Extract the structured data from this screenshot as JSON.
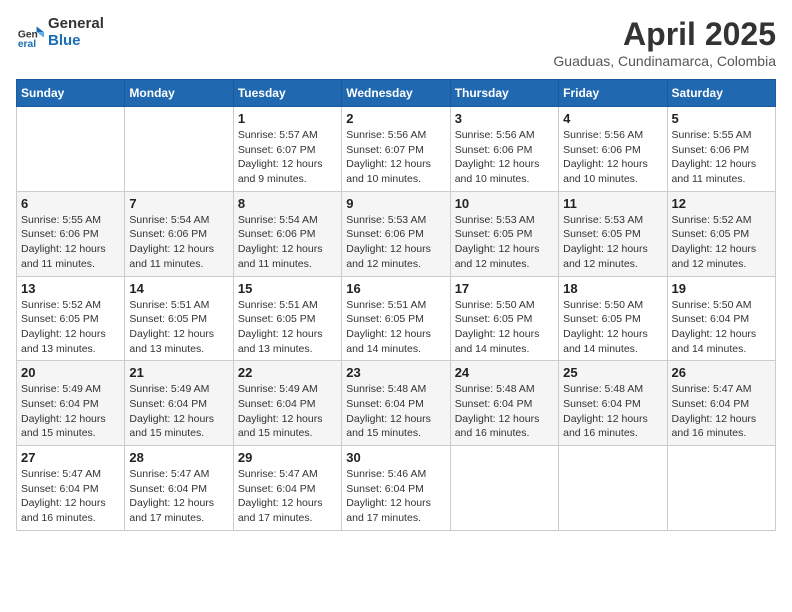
{
  "header": {
    "logo": {
      "general": "General",
      "blue": "Blue"
    },
    "title": "April 2025",
    "subtitle": "Guaduas, Cundinamarca, Colombia"
  },
  "weekdays": [
    "Sunday",
    "Monday",
    "Tuesday",
    "Wednesday",
    "Thursday",
    "Friday",
    "Saturday"
  ],
  "weeks": [
    [
      {
        "day": "",
        "sunrise": "",
        "sunset": "",
        "daylight": ""
      },
      {
        "day": "",
        "sunrise": "",
        "sunset": "",
        "daylight": ""
      },
      {
        "day": "1",
        "sunrise": "Sunrise: 5:57 AM",
        "sunset": "Sunset: 6:07 PM",
        "daylight": "Daylight: 12 hours and 9 minutes."
      },
      {
        "day": "2",
        "sunrise": "Sunrise: 5:56 AM",
        "sunset": "Sunset: 6:07 PM",
        "daylight": "Daylight: 12 hours and 10 minutes."
      },
      {
        "day": "3",
        "sunrise": "Sunrise: 5:56 AM",
        "sunset": "Sunset: 6:06 PM",
        "daylight": "Daylight: 12 hours and 10 minutes."
      },
      {
        "day": "4",
        "sunrise": "Sunrise: 5:56 AM",
        "sunset": "Sunset: 6:06 PM",
        "daylight": "Daylight: 12 hours and 10 minutes."
      },
      {
        "day": "5",
        "sunrise": "Sunrise: 5:55 AM",
        "sunset": "Sunset: 6:06 PM",
        "daylight": "Daylight: 12 hours and 11 minutes."
      }
    ],
    [
      {
        "day": "6",
        "sunrise": "Sunrise: 5:55 AM",
        "sunset": "Sunset: 6:06 PM",
        "daylight": "Daylight: 12 hours and 11 minutes."
      },
      {
        "day": "7",
        "sunrise": "Sunrise: 5:54 AM",
        "sunset": "Sunset: 6:06 PM",
        "daylight": "Daylight: 12 hours and 11 minutes."
      },
      {
        "day": "8",
        "sunrise": "Sunrise: 5:54 AM",
        "sunset": "Sunset: 6:06 PM",
        "daylight": "Daylight: 12 hours and 11 minutes."
      },
      {
        "day": "9",
        "sunrise": "Sunrise: 5:53 AM",
        "sunset": "Sunset: 6:06 PM",
        "daylight": "Daylight: 12 hours and 12 minutes."
      },
      {
        "day": "10",
        "sunrise": "Sunrise: 5:53 AM",
        "sunset": "Sunset: 6:05 PM",
        "daylight": "Daylight: 12 hours and 12 minutes."
      },
      {
        "day": "11",
        "sunrise": "Sunrise: 5:53 AM",
        "sunset": "Sunset: 6:05 PM",
        "daylight": "Daylight: 12 hours and 12 minutes."
      },
      {
        "day": "12",
        "sunrise": "Sunrise: 5:52 AM",
        "sunset": "Sunset: 6:05 PM",
        "daylight": "Daylight: 12 hours and 12 minutes."
      }
    ],
    [
      {
        "day": "13",
        "sunrise": "Sunrise: 5:52 AM",
        "sunset": "Sunset: 6:05 PM",
        "daylight": "Daylight: 12 hours and 13 minutes."
      },
      {
        "day": "14",
        "sunrise": "Sunrise: 5:51 AM",
        "sunset": "Sunset: 6:05 PM",
        "daylight": "Daylight: 12 hours and 13 minutes."
      },
      {
        "day": "15",
        "sunrise": "Sunrise: 5:51 AM",
        "sunset": "Sunset: 6:05 PM",
        "daylight": "Daylight: 12 hours and 13 minutes."
      },
      {
        "day": "16",
        "sunrise": "Sunrise: 5:51 AM",
        "sunset": "Sunset: 6:05 PM",
        "daylight": "Daylight: 12 hours and 14 minutes."
      },
      {
        "day": "17",
        "sunrise": "Sunrise: 5:50 AM",
        "sunset": "Sunset: 6:05 PM",
        "daylight": "Daylight: 12 hours and 14 minutes."
      },
      {
        "day": "18",
        "sunrise": "Sunrise: 5:50 AM",
        "sunset": "Sunset: 6:05 PM",
        "daylight": "Daylight: 12 hours and 14 minutes."
      },
      {
        "day": "19",
        "sunrise": "Sunrise: 5:50 AM",
        "sunset": "Sunset: 6:04 PM",
        "daylight": "Daylight: 12 hours and 14 minutes."
      }
    ],
    [
      {
        "day": "20",
        "sunrise": "Sunrise: 5:49 AM",
        "sunset": "Sunset: 6:04 PM",
        "daylight": "Daylight: 12 hours and 15 minutes."
      },
      {
        "day": "21",
        "sunrise": "Sunrise: 5:49 AM",
        "sunset": "Sunset: 6:04 PM",
        "daylight": "Daylight: 12 hours and 15 minutes."
      },
      {
        "day": "22",
        "sunrise": "Sunrise: 5:49 AM",
        "sunset": "Sunset: 6:04 PM",
        "daylight": "Daylight: 12 hours and 15 minutes."
      },
      {
        "day": "23",
        "sunrise": "Sunrise: 5:48 AM",
        "sunset": "Sunset: 6:04 PM",
        "daylight": "Daylight: 12 hours and 15 minutes."
      },
      {
        "day": "24",
        "sunrise": "Sunrise: 5:48 AM",
        "sunset": "Sunset: 6:04 PM",
        "daylight": "Daylight: 12 hours and 16 minutes."
      },
      {
        "day": "25",
        "sunrise": "Sunrise: 5:48 AM",
        "sunset": "Sunset: 6:04 PM",
        "daylight": "Daylight: 12 hours and 16 minutes."
      },
      {
        "day": "26",
        "sunrise": "Sunrise: 5:47 AM",
        "sunset": "Sunset: 6:04 PM",
        "daylight": "Daylight: 12 hours and 16 minutes."
      }
    ],
    [
      {
        "day": "27",
        "sunrise": "Sunrise: 5:47 AM",
        "sunset": "Sunset: 6:04 PM",
        "daylight": "Daylight: 12 hours and 16 minutes."
      },
      {
        "day": "28",
        "sunrise": "Sunrise: 5:47 AM",
        "sunset": "Sunset: 6:04 PM",
        "daylight": "Daylight: 12 hours and 17 minutes."
      },
      {
        "day": "29",
        "sunrise": "Sunrise: 5:47 AM",
        "sunset": "Sunset: 6:04 PM",
        "daylight": "Daylight: 12 hours and 17 minutes."
      },
      {
        "day": "30",
        "sunrise": "Sunrise: 5:46 AM",
        "sunset": "Sunset: 6:04 PM",
        "daylight": "Daylight: 12 hours and 17 minutes."
      },
      {
        "day": "",
        "sunrise": "",
        "sunset": "",
        "daylight": ""
      },
      {
        "day": "",
        "sunrise": "",
        "sunset": "",
        "daylight": ""
      },
      {
        "day": "",
        "sunrise": "",
        "sunset": "",
        "daylight": ""
      }
    ]
  ]
}
